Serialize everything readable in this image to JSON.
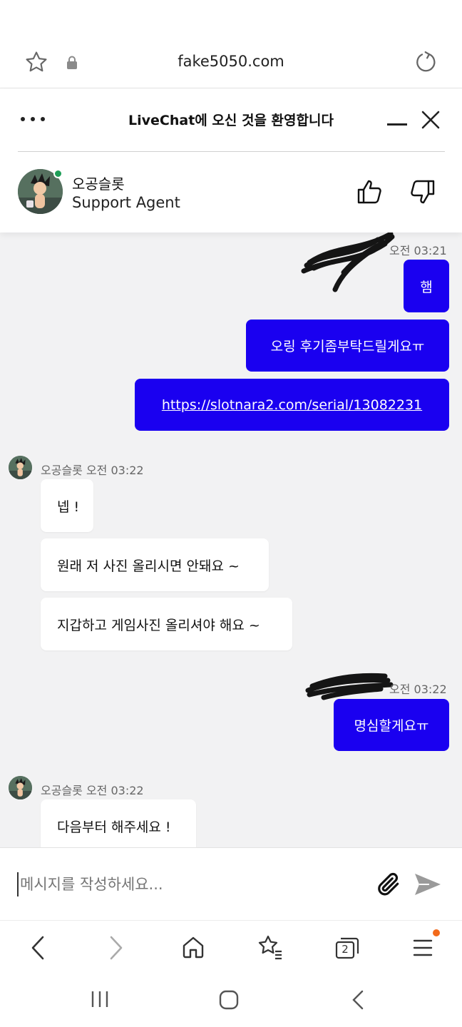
{
  "browser": {
    "url": "fake5050.com",
    "tab_count": "2"
  },
  "chat_header": {
    "title": "LiveChat에 오신 것을 환영합니다",
    "agent_name": "오공슬롯",
    "agent_role": "Support Agent",
    "online_color": "#1e9e57"
  },
  "messages": {
    "out_time_1": "오전 03:21",
    "out_1": "햄",
    "out_2": "오링 후기좀부탁드릴게요ㅠ",
    "out_3_link": "https://slotnara2.com/serial/13082231",
    "in_meta_1": "오공슬롯 오전 03:22",
    "in_1": "넵 !",
    "in_2": "원래 저 사진 올리시면 안돼요 ~",
    "in_3": "지갑하고 게임사진 올리셔야 해요 ~",
    "out_time_2": "오전 03:22",
    "out_4": "명심할게요ㅠ",
    "in_meta_2": "오공슬롯 오전 03:22",
    "in_4": "다음부터 해주세요 !"
  },
  "composer": {
    "placeholder": "메시지를 작성하세요..."
  },
  "colors": {
    "accent": "#1a00f0",
    "chat_background": "#f2f2f3",
    "notification_dot": "#f26a1b"
  },
  "icons": {
    "url_bar": [
      "star-icon",
      "lock-icon",
      "reload-icon"
    ],
    "header": [
      "more-options-icon",
      "minimize-icon",
      "close-icon",
      "thumbs-up-icon",
      "thumbs-down-icon"
    ],
    "composer": [
      "attachment-icon",
      "send-icon"
    ],
    "browser_nav": [
      "back-icon",
      "forward-icon",
      "home-icon",
      "bookmarks-icon",
      "tabs-icon",
      "menu-icon"
    ],
    "system_nav": [
      "recents-icon",
      "home-button-icon",
      "system-back-icon"
    ]
  }
}
